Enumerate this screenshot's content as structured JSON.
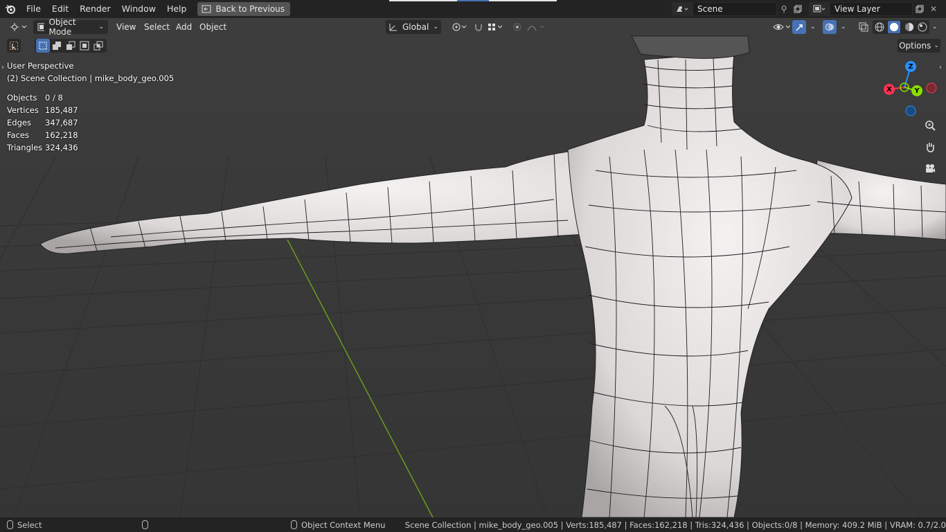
{
  "topbar": {
    "menus": [
      "File",
      "Edit",
      "Render",
      "Window",
      "Help"
    ],
    "back_button": "Back to Previous",
    "scene": "Scene",
    "view_layer": "View Layer"
  },
  "viewport_header": {
    "mode": "Object Mode",
    "menus": [
      "View",
      "Select",
      "Add",
      "Object"
    ],
    "orientation": "Global",
    "options": "Options"
  },
  "overlay": {
    "perspective": "User Perspective",
    "collection": "(2) Scene Collection | mike_body_geo.005",
    "stats": [
      {
        "label": "Objects",
        "value": "0 / 8"
      },
      {
        "label": "Vertices",
        "value": "185,487"
      },
      {
        "label": "Edges",
        "value": "347,687"
      },
      {
        "label": "Faces",
        "value": "162,218"
      },
      {
        "label": "Triangles",
        "value": "324,436"
      }
    ]
  },
  "gizmo": {
    "z": "Z",
    "y": "Y",
    "x": "X"
  },
  "statusbar": {
    "select": "Select",
    "context_menu": "Object Context Menu",
    "info": "Scene Collection | mike_body_geo.005 | Verts:185,487 | Faces:162,218 | Tris:324,436 | Objects:0/8 | Memory: 409.2 MiB | VRAM: 0.7/2.0"
  },
  "colors": {
    "accent": "#4772b3",
    "axis_x": "#ff3352",
    "axis_y": "#8bdc00",
    "axis_z": "#2890ff"
  }
}
